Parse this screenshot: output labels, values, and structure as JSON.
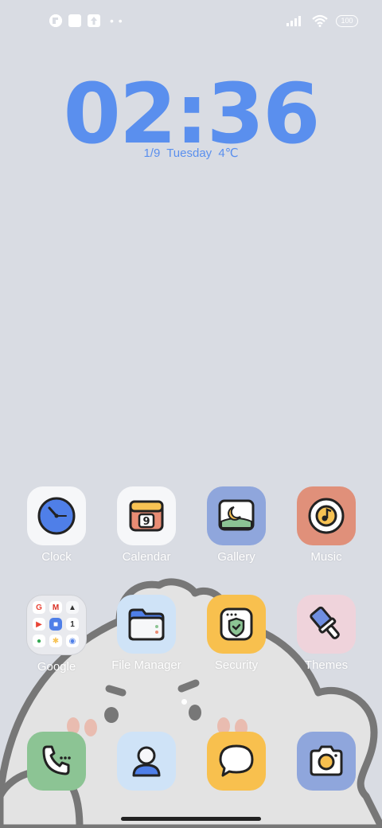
{
  "status_bar": {
    "battery": "100",
    "icons": [
      "notification-app-icon",
      "square-notification-icon",
      "upload-notification-icon",
      "more-dots-icon",
      "signal-icon",
      "wifi-icon",
      "battery-icon"
    ]
  },
  "clock": {
    "time": "02:36",
    "date": "1/9",
    "weekday": "Tuesday",
    "temperature": "4℃"
  },
  "apps": [
    {
      "label": "Clock",
      "icon": "clock-icon",
      "bg": "#f6f7f9"
    },
    {
      "label": "Calendar",
      "icon": "calendar-icon",
      "bg": "#f6f7f9",
      "badge": "9"
    },
    {
      "label": "Gallery",
      "icon": "gallery-icon",
      "bg": "#8fa6dc"
    },
    {
      "label": "Music",
      "icon": "music-icon",
      "bg": "#e0907a"
    },
    {
      "label": "Google",
      "icon": "folder-icon",
      "bg": "#e9eaee"
    },
    {
      "label": "File Manager",
      "icon": "file-manager-icon",
      "bg": "#cfe3f7"
    },
    {
      "label": "Security",
      "icon": "security-icon",
      "bg": "#f8c04e"
    },
    {
      "label": "Themes",
      "icon": "themes-icon",
      "bg": "#efd3db"
    }
  ],
  "dock": [
    {
      "name": "phone",
      "icon": "phone-icon",
      "bg": "#8cc494"
    },
    {
      "name": "contacts",
      "icon": "contacts-icon",
      "bg": "#cfe3f7"
    },
    {
      "name": "messages",
      "icon": "messages-icon",
      "bg": "#f8c04e"
    },
    {
      "name": "camera",
      "icon": "camera-icon",
      "bg": "#8fa6dc"
    }
  ],
  "colors": {
    "accent": "#5a8fee",
    "wallpaper": "#d9dce3"
  }
}
